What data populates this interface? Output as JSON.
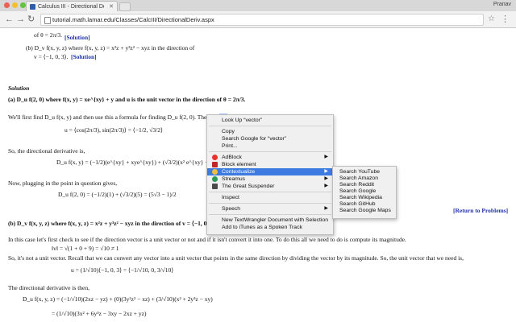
{
  "tab": {
    "title": "Calculus III - Directional Deriv..."
  },
  "user": {
    "name": "Pranav"
  },
  "omnibox": {
    "url": "tutorial.math.lamar.edu/Classes/CalcIII/DirectionalDeriv.aspx"
  },
  "content": {
    "line_a": "of θ = 2π/3.",
    "sol1": "[Solution]",
    "prob_b": "(b)  D_v f(x, y, z) where f(x, y, z) = x²z + y³z² − xyz in the direction of",
    "prob_b2": "v = ⟨−1, 0, 3⟩.",
    "sol2": "[Solution]",
    "solution_hdr": "Solution",
    "part_a": "(a)  D_u f(2, 0) where f(x, y) = xe^{xy} + y and u is the unit vector in the direction of θ = 2π/3.",
    "find_text": "We'll first find D_u f(x, y) and then use this a formula for finding D_u f(2, 0).  The unit ",
    "find_hl": "vec",
    "unit_eq": "u = ⟨cos(2π/3), sin(2π/3)⟩ = ⟨−1/2, √3/2⟩",
    "dir_text": "So, the directional derivative is,",
    "dir_eq": "D_u f(x, y) = (−1/2)(e^{xy} + xye^{xy}) + (√3/2)(x² e^{xy} + 1)",
    "plug_text": "Now, plugging in the point in question gives,",
    "plug_eq": "D_u f(2, 0) = (−1/2)(1) + (√3/2)(5) = (5√3 − 1)/2",
    "return_link": "[Return to Problems]",
    "part_b": "(b)  D_v f(x, y, z) where f(x, y, z) = x²z + y³z² − xyz in the direction of v = ⟨−1, 0, 3⟩.",
    "check_text": "In this case let's first check to see if the direction vector is a unit vector or not and if it isn't convert it into one.  To do this all we need to do is compute its magnitude.",
    "mag_eq": "‖v‖ = √(1 + 0 + 9) = √10 ≠ 1",
    "notunit_text": "So, it's not a unit vector.  Recall that we can convert any vector into a unit vector that points in the same direction by dividing the vector by its magnitude.  So, the unit vector that we need is,",
    "u_eq": "u = (1/√10)⟨−1, 0, 3⟩ = ⟨−1/√10, 0, 3/√10⟩",
    "dd_text": "The directional derivative is then,",
    "dd_eq": "D_u f(x, y, z) = (−1/√10)(2xz − yz) + (0)(3y²z² − xz) + (3/√10)(x² + 2y³z − xy)",
    "dd_eq2": "= (1/√10)(3x² + 6y³z − 3xy − 2xz + yz)"
  },
  "context_menu": {
    "items": [
      {
        "label": "Look Up “vector”"
      },
      {
        "label": "Copy"
      },
      {
        "label": "Search Google for “vector”"
      },
      {
        "label": "Print..."
      },
      {
        "label": "AdBlock"
      },
      {
        "label": "Block element"
      },
      {
        "label": "Contextualize"
      },
      {
        "label": "Streamus"
      },
      {
        "label": "The Great Suspender"
      },
      {
        "label": "Inspect"
      },
      {
        "label": "Speech"
      },
      {
        "label": "New TextWrangler Document with Selection"
      },
      {
        "label": "Add to iTunes as a Spoken Track"
      }
    ]
  },
  "submenu": {
    "items": [
      {
        "label": "Search YouTube"
      },
      {
        "label": "Search Amazon"
      },
      {
        "label": "Search Reddit"
      },
      {
        "label": "Search Google"
      },
      {
        "label": "Search Wikipedia"
      },
      {
        "label": "Search GitHub"
      },
      {
        "label": "Search Google Maps"
      }
    ]
  },
  "colors": {
    "active_menu": "#3d7be0",
    "link": "#2233aa",
    "selection": "#aac8ff"
  }
}
